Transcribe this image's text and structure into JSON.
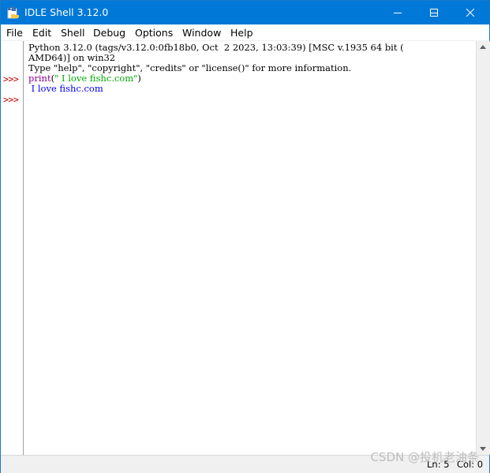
{
  "window": {
    "title": "IDLE Shell 3.12.0",
    "colors": {
      "titlebar": "#0078d7",
      "prompt": "#c00000",
      "builtin": "#900090",
      "string": "#00aa00",
      "output": "#0000ff"
    }
  },
  "menu": {
    "items": [
      "File",
      "Edit",
      "Shell",
      "Debug",
      "Options",
      "Window",
      "Help"
    ]
  },
  "shell": {
    "banner_line1": "Python 3.12.0 (tags/v3.12.0:0fb18b0, Oct  2 2023, 13:03:39) [MSC v.1935 64 bit (",
    "banner_line2": "AMD64)] on win32",
    "banner_line3": "Type \"help\", \"copyright\", \"credits\" or \"license()\" for more information.",
    "prompt": ">>>",
    "input_func": "print",
    "input_open": "(",
    "input_string": "\" I love fishc.com\"",
    "input_close": ")",
    "output": " I love fishc.com"
  },
  "status": {
    "line": "Ln: 5",
    "col": "Col: 0"
  },
  "watermark": "CSDN @投机老油条"
}
